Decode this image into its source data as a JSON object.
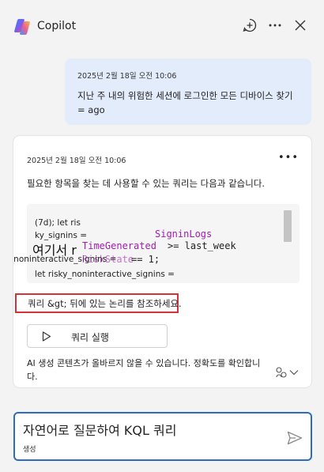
{
  "header": {
    "title": "Copilot"
  },
  "user_message": {
    "timestamp": "2025년 2월 18일 오전 10:06",
    "text": "지난 주 내의 위험한 세션에 로그인한 모든 디바이스 찾기 = ago"
  },
  "response": {
    "timestamp": "2025년 2월 18일 오전 10:06",
    "intro": "필요한 항목을 찾는 데 사용할 수 있는 쿼리는 다음과 같습니다.",
    "code": {
      "line1": "(7d); let ris",
      "line2": "ky_signins =",
      "keyword_signinlogs": "SigninLogs",
      "overlay_text": "여기서 r",
      "time_generated": "TimeGenerated",
      "ge_last_week": ">= last_week",
      "overflow_left": "ky_noninteractive_signins =",
      "riskstate": "RiskState",
      "eq_one": "== 1;",
      "line_last": "let risky_noninteractive_signins ="
    },
    "reference_text": "쿼리 &gt; 뒤에 있는 논리를 참조하세요.",
    "run_button_label": "쿼리 실행",
    "disclaimer": "AI 생성 콘텐츠가 올바르지 않을 수 있습니다. 정확도를 확인합니다."
  },
  "input": {
    "placeholder": "자연어로 질문하여 KQL 쿼리",
    "placeholder_line2": "생성"
  },
  "colors": {
    "accent": "#2b6dbf",
    "highlight_border": "#d13438",
    "code_keyword": "#a21caf",
    "user_bubble": "#e3ecfa"
  }
}
